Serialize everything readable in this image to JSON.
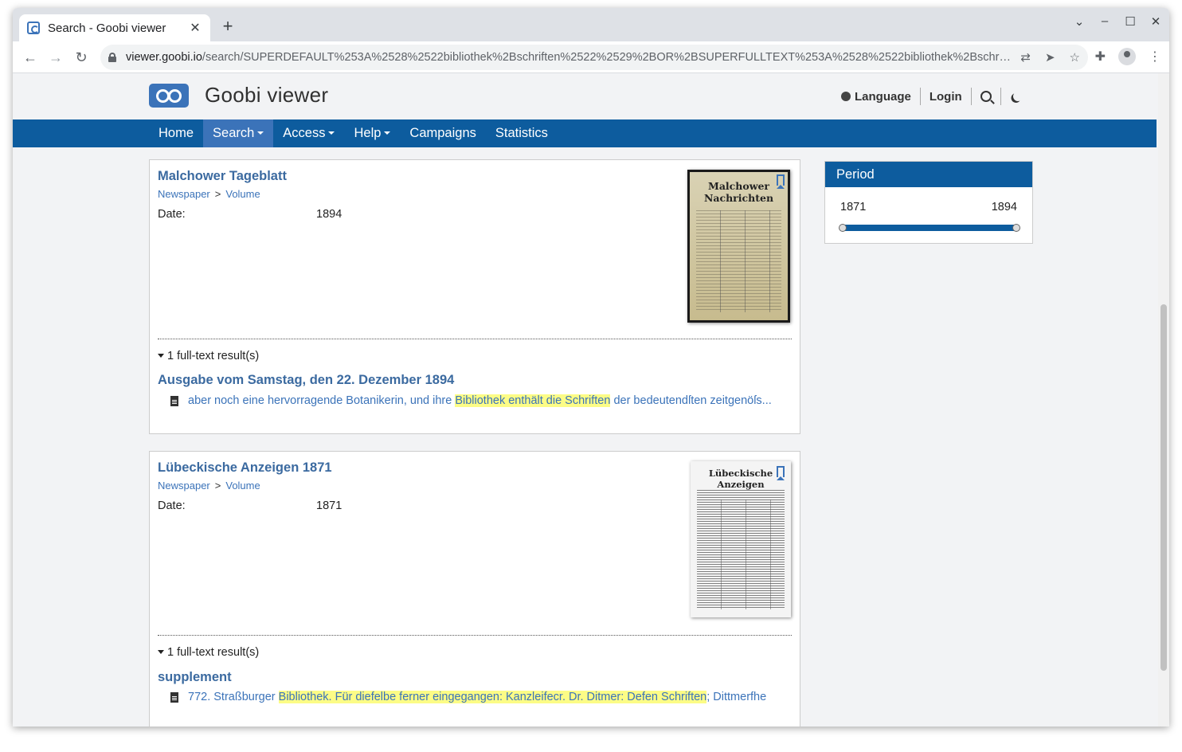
{
  "browser": {
    "tab_title": "Search - Goobi viewer",
    "url_host": "viewer.goobi.io",
    "url_path": "/search/SUPERDEFAULT%253A%2528%2522bibliothek%2Bschriften%2522%2529%2BOR%2BSUPERFULLTEXT%253A%2528%2522bibliothek%2Bschriften%..."
  },
  "site": {
    "brand": "Goobi viewer",
    "language_label": "Language",
    "login_label": "Login"
  },
  "nav": {
    "items": [
      {
        "label": "Home",
        "dropdown": false,
        "active": false
      },
      {
        "label": "Search",
        "dropdown": true,
        "active": true
      },
      {
        "label": "Access",
        "dropdown": true,
        "active": false
      },
      {
        "label": "Help",
        "dropdown": true,
        "active": false
      },
      {
        "label": "Campaigns",
        "dropdown": false,
        "active": false
      },
      {
        "label": "Statistics",
        "dropdown": false,
        "active": false
      }
    ]
  },
  "results": [
    {
      "title": "Malchower Tageblatt",
      "breadcrumb": [
        "Newspaper",
        "Volume"
      ],
      "date_label": "Date:",
      "date_value": "1894",
      "thumb_heading": "Malchower Nachrichten",
      "fulltext_count": "1 full-text result(s)",
      "fulltext_title": "Ausgabe vom Samstag, den 22. Dezember 1894",
      "snippet_pre": "aber noch eine hervorragende Botanikerin, und ihre ",
      "snippet_hl": "Bibliothek enthält die Schriften",
      "snippet_post": " der bedeutendſten zeitgenöſs..."
    },
    {
      "title": "Lübeckische Anzeigen 1871",
      "breadcrumb": [
        "Newspaper",
        "Volume"
      ],
      "date_label": "Date:",
      "date_value": "1871",
      "thumb_heading": "Lübeckische Anzeigen",
      "fulltext_count": "1 full-text result(s)",
      "fulltext_title": "supplement",
      "snippet_pre": "772. Straßburger ",
      "snippet_hl": "Bibliothek. Für diefelbe ferner eingegangen: Kanzleifecr. Dr. Ditmer: Defen Schriften",
      "snippet_post": "; Dittmerfhe"
    }
  ],
  "period": {
    "title": "Period",
    "min": "1871",
    "max": "1894"
  },
  "colors": {
    "nav_bg": "#0d5c9e",
    "nav_active": "#3b73b9",
    "link": "#3b6aa0",
    "highlight": "#fcfc86"
  }
}
